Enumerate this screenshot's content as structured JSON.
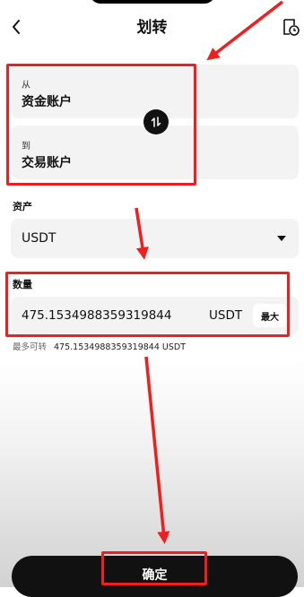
{
  "header": {
    "title": "划转"
  },
  "transfer": {
    "from_label": "从",
    "from_value": "资金账户",
    "to_label": "到",
    "to_value": "交易账户"
  },
  "asset": {
    "label": "资产",
    "selected": "USDT"
  },
  "quantity": {
    "label": "数量",
    "value": "475.1534988359319844",
    "unit": "USDT",
    "max_label": "最大"
  },
  "available": {
    "label": "最多可转",
    "value": "475.1534988359319844 USDT"
  },
  "confirm_label": "确定",
  "annotation_color": "#f01e1e",
  "icons": [
    "chevron-left-icon",
    "history-icon",
    "swap-icon",
    "dropdown-caret-icon",
    "red-arrow-annotation"
  ]
}
